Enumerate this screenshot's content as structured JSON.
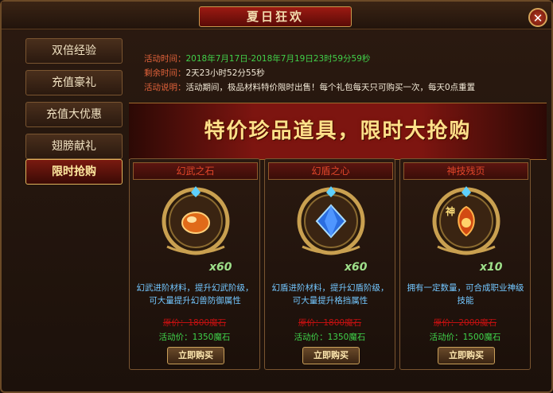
{
  "window": {
    "title": "夏日狂欢",
    "close_label": "✕"
  },
  "sidebar": {
    "items": [
      {
        "label": "双倍经验",
        "active": false
      },
      {
        "label": "充值豪礼",
        "active": false
      },
      {
        "label": "充值大优惠",
        "active": false
      },
      {
        "label": "翅膀献礼",
        "active": false
      },
      {
        "label": "限时抢购",
        "active": true
      }
    ]
  },
  "info": {
    "time_label": "活动时间：",
    "time_value": "2018年7月17日-2018年7月19日23时59分59秒",
    "remaining_label": "剩余时间：",
    "remaining_value": "2天23小时52分55秒",
    "desc_label": "活动说明：",
    "desc_value": "活动期间，极品材料特价限时出售！每个礼包每天只可购买一次，每天0点重置"
  },
  "banner": {
    "text": "特价珍品道具，限时大抢购"
  },
  "cards": [
    {
      "name": "幻武之石",
      "count": "x60",
      "description": "幻武进阶材料，提升幻武阶级，可大量提升幻兽防御属性",
      "original_price": "原价：1800魔石",
      "sale_price": "活动价：1350魔石",
      "buy_label": "立即购买",
      "icon": "orange-stone-icon",
      "color": "#e06a1a"
    },
    {
      "name": "幻盾之心",
      "count": "x60",
      "description": "幻盾进阶材料，提升幻盾阶级，可大量提升格挡属性",
      "original_price": "原价：1800魔石",
      "sale_price": "活动价：1350魔石",
      "buy_label": "立即购买",
      "icon": "blue-gem-icon",
      "color": "#2a6de0"
    },
    {
      "name": "神技残页",
      "count": "x10",
      "description": "拥有一定数量，可合成职业神级技能",
      "original_price": "原价：2000魔石",
      "sale_price": "活动价：1500魔石",
      "buy_label": "立即购买",
      "icon": "skill-scroll-icon",
      "color": "#d24a12",
      "badge": "神"
    }
  ]
}
